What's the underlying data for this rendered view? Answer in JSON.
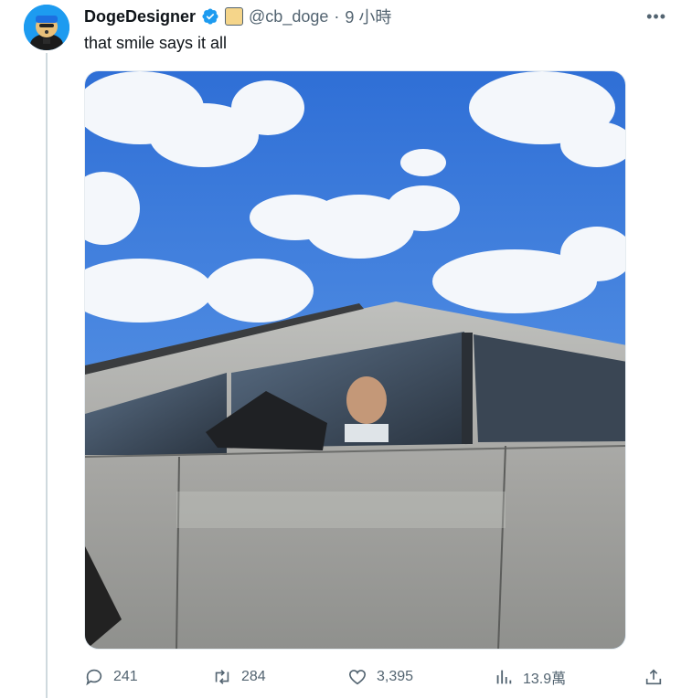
{
  "tweet": {
    "display_name": "DogeDesigner",
    "handle": "@cb_doge",
    "separator": "·",
    "time": "9 小時",
    "text": "that smile says it all",
    "more": "•••"
  },
  "actions": {
    "reply_count": "241",
    "retweet_count": "284",
    "like_count": "3,395",
    "views_count": "13.9萬"
  },
  "icons": {
    "verified": "verified-badge-icon",
    "affiliate": "affiliate-badge-icon",
    "reply": "reply-icon",
    "retweet": "retweet-icon",
    "like": "heart-icon",
    "views": "views-icon",
    "share": "share-icon"
  },
  "colors": {
    "accent": "#1d9bf0",
    "text": "#0f1419",
    "muted": "#536471"
  }
}
